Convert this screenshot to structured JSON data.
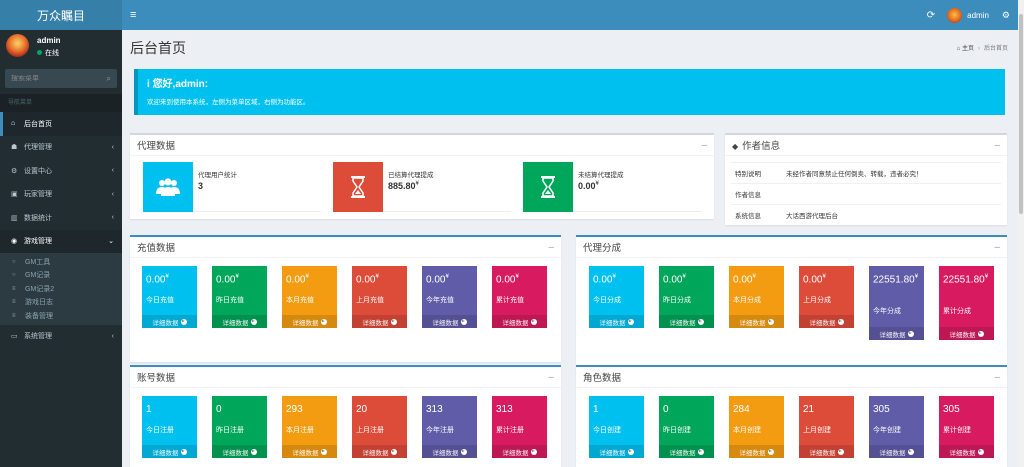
{
  "app": {
    "title": "万众瞩目"
  },
  "header": {
    "toggle_icon": "≡",
    "refresh_icon": "⟳",
    "user": "admin",
    "settings_icon": "⚙"
  },
  "sidebar": {
    "user": {
      "name": "admin",
      "status": "在线"
    },
    "search": {
      "placeholder": "搜索菜单",
      "icon": "⌕"
    },
    "header": "导航菜单",
    "items": [
      {
        "label": "后台首页",
        "icon": "⌂",
        "arrow": ""
      },
      {
        "label": "代理管理",
        "icon": "☗",
        "arrow": "‹"
      },
      {
        "label": "设置中心",
        "icon": "⚙",
        "arrow": "‹"
      },
      {
        "label": "玩家管理",
        "icon": "▣",
        "arrow": "‹"
      },
      {
        "label": "数据统计",
        "icon": "▥",
        "arrow": "‹"
      },
      {
        "label": "游戏管理",
        "icon": "◉",
        "arrow": "⌄"
      }
    ],
    "subitems": [
      {
        "label": "GM工具",
        "icon": "○"
      },
      {
        "label": "GM记录",
        "icon": "○"
      },
      {
        "label": "GM记录2",
        "icon": "≡"
      },
      {
        "label": "游戏日志",
        "icon": "≡"
      },
      {
        "label": "装备管理",
        "icon": "≡"
      }
    ],
    "last_item": {
      "label": "系统管理",
      "icon": "▭",
      "arrow": "‹"
    }
  },
  "page": {
    "title": "后台首页",
    "breadcrumb": {
      "home": "主页",
      "sep": "›",
      "current": "后台首页",
      "home_icon": "⌂"
    }
  },
  "callout": {
    "title": "您好,admin:",
    "icon": "i",
    "text": "欢迎来到使用本系统，左侧为菜单区域，右侧为功能区。"
  },
  "agent_data": {
    "title": "代理数据",
    "collapse": "–",
    "items": [
      {
        "label": "代理用户统计",
        "value": "3",
        "unit": "",
        "color": "#00c0ef",
        "icon": "users-icon"
      },
      {
        "label": "已结算代理提成",
        "value": "885.80",
        "unit": "¥",
        "color": "#dd4b39",
        "icon": "hourglass-icon"
      },
      {
        "label": "未结算代理提成",
        "value": "0.00",
        "unit": "¥",
        "color": "#00a65a",
        "icon": "hourglass-icon"
      }
    ]
  },
  "author_info": {
    "title": "作者信息",
    "collapse": "–",
    "icon": "◆",
    "rows": [
      {
        "key": "特别说明",
        "value": "未经作者同意禁止任何倒卖、转载，违者必究！"
      },
      {
        "key": "作者信息",
        "value": ""
      },
      {
        "key": "系统信息",
        "value": "大话西游代理后台"
      }
    ]
  },
  "recharge": {
    "title": "充值数据",
    "collapse": "–",
    "footer": "详细数据",
    "items": [
      {
        "value": "0.00",
        "unit": "¥",
        "label": "今日充值"
      },
      {
        "value": "0.00",
        "unit": "¥",
        "label": "昨日充值"
      },
      {
        "value": "0.00",
        "unit": "¥",
        "label": "本月充值"
      },
      {
        "value": "0.00",
        "unit": "¥",
        "label": "上月充值"
      },
      {
        "value": "0.00",
        "unit": "¥",
        "label": "今年充值"
      },
      {
        "value": "0.00",
        "unit": "¥",
        "label": "累计充值"
      }
    ]
  },
  "commission": {
    "title": "代理分成",
    "collapse": "–",
    "footer": "详细数据",
    "items": [
      {
        "value": "0.00",
        "unit": "¥",
        "label": "今日分成"
      },
      {
        "value": "0.00",
        "unit": "¥",
        "label": "昨日分成"
      },
      {
        "value": "0.00",
        "unit": "¥",
        "label": "本月分成"
      },
      {
        "value": "0.00",
        "unit": "¥",
        "label": "上月分成"
      },
      {
        "value": "22551.80",
        "unit": "¥",
        "label": "今年分成"
      },
      {
        "value": "22551.80",
        "unit": "¥",
        "label": "累计分成"
      }
    ]
  },
  "accounts": {
    "title": "账号数据",
    "collapse": "–",
    "footer": "详细数据",
    "items": [
      {
        "value": "1",
        "label": "今日注册"
      },
      {
        "value": "0",
        "label": "昨日注册"
      },
      {
        "value": "293",
        "label": "本月注册"
      },
      {
        "value": "20",
        "label": "上月注册"
      },
      {
        "value": "313",
        "label": "今年注册"
      },
      {
        "value": "313",
        "label": "累计注册"
      }
    ]
  },
  "roles": {
    "title": "角色数据",
    "collapse": "–",
    "footer": "详细数据",
    "items": [
      {
        "value": "1",
        "label": "今日创建"
      },
      {
        "value": "0",
        "label": "昨日创建"
      },
      {
        "value": "284",
        "label": "本月创建"
      },
      {
        "value": "21",
        "label": "上月创建"
      },
      {
        "value": "305",
        "label": "今年创建"
      },
      {
        "value": "305",
        "label": "累计创建"
      }
    ]
  }
}
